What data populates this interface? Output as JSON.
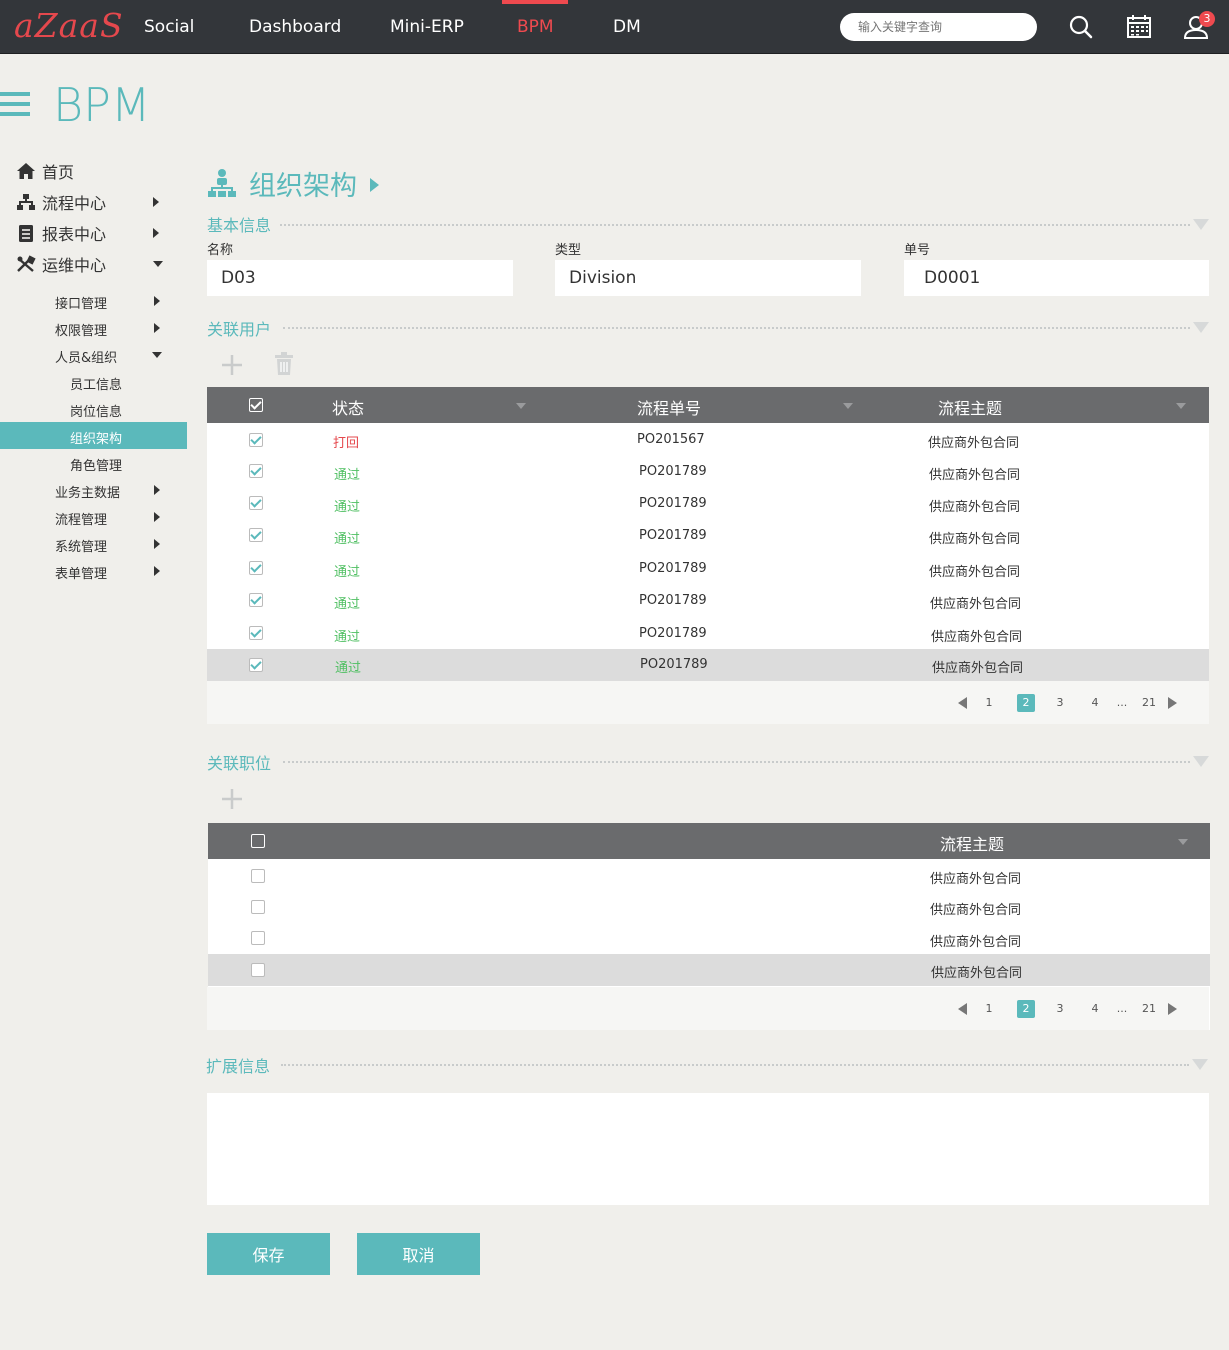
{
  "header": {
    "logo": "aZaaS",
    "nav": [
      "Social",
      "Dashboard",
      "Mini-ERP",
      "BPM",
      "DM"
    ],
    "active_nav": "BPM",
    "search_placeholder": "输入关键字查询",
    "notification_count": "3"
  },
  "page": {
    "title": "BPM"
  },
  "sidebar": {
    "items": [
      {
        "label": "首页",
        "icon": "home-icon",
        "arrow": ""
      },
      {
        "label": "流程中心",
        "icon": "sitemap-icon",
        "arrow": "right"
      },
      {
        "label": "报表中心",
        "icon": "document-icon",
        "arrow": "right"
      },
      {
        "label": "运维中心",
        "icon": "tools-icon",
        "arrow": "down"
      }
    ],
    "subitems": [
      {
        "label": "接口管理",
        "level": 1,
        "arrow": "right"
      },
      {
        "label": "权限管理",
        "level": 1,
        "arrow": "right"
      },
      {
        "label": "人员&组织",
        "level": 1,
        "arrow": "down"
      },
      {
        "label": "员工信息",
        "level": 2,
        "arrow": ""
      },
      {
        "label": "岗位信息",
        "level": 2,
        "arrow": ""
      },
      {
        "label": "组织架构",
        "level": 2,
        "arrow": "",
        "active": true
      },
      {
        "label": "角色管理",
        "level": 2,
        "arrow": ""
      },
      {
        "label": "业务主数据",
        "level": 1,
        "arrow": "right"
      },
      {
        "label": "流程管理",
        "level": 1,
        "arrow": "right"
      },
      {
        "label": "系统管理",
        "level": 1,
        "arrow": "right"
      },
      {
        "label": "表单管理",
        "level": 1,
        "arrow": "right"
      }
    ]
  },
  "main": {
    "heading": "组织架构",
    "basic": {
      "title": "基本信息",
      "name_label": "名称",
      "name_value": "D03",
      "type_label": "类型",
      "type_value": "Division",
      "no_label": "单号",
      "no_value": "D0001"
    },
    "users": {
      "title": "关联用户",
      "columns": [
        "状态",
        "流程单号",
        "流程主题"
      ],
      "rows": [
        {
          "status": "打回",
          "status_color": "#e5484d",
          "no": "PO201567",
          "subject": "供应商外包合同"
        },
        {
          "status": "通过",
          "status_color": "#4fbf62",
          "no": "PO201789",
          "subject": "供应商外包合同"
        },
        {
          "status": "通过",
          "status_color": "#4fbf62",
          "no": "PO201789",
          "subject": "供应商外包合同"
        },
        {
          "status": "通过",
          "status_color": "#4fbf62",
          "no": "PO201789",
          "subject": "供应商外包合同"
        },
        {
          "status": "通过",
          "status_color": "#4fbf62",
          "no": "PO201789",
          "subject": "供应商外包合同"
        },
        {
          "status": "通过",
          "status_color": "#4fbf62",
          "no": "PO201789",
          "subject": "供应商外包合同"
        },
        {
          "status": "通过",
          "status_color": "#4fbf62",
          "no": "PO201789",
          "subject": "供应商外包合同"
        },
        {
          "status": "通过",
          "status_color": "#4fbf62",
          "no": "PO201789",
          "subject": "供应商外包合同"
        }
      ],
      "pages": [
        "1",
        "2",
        "3",
        "4",
        "...",
        "21"
      ],
      "current_page": "2"
    },
    "positions": {
      "title": "关联职位",
      "column": "流程主题",
      "rows": [
        "供应商外包合同",
        "供应商外包合同",
        "供应商外包合同",
        "供应商外包合同"
      ],
      "pages": [
        "1",
        "2",
        "3",
        "4",
        "...",
        "21"
      ],
      "current_page": "2"
    },
    "extension": {
      "title": "扩展信息"
    },
    "save_label": "保存",
    "cancel_label": "取消"
  },
  "colors": {
    "accent": "#5bb9bb",
    "nav_bg": "#33363a",
    "active": "#ef4a4f"
  }
}
